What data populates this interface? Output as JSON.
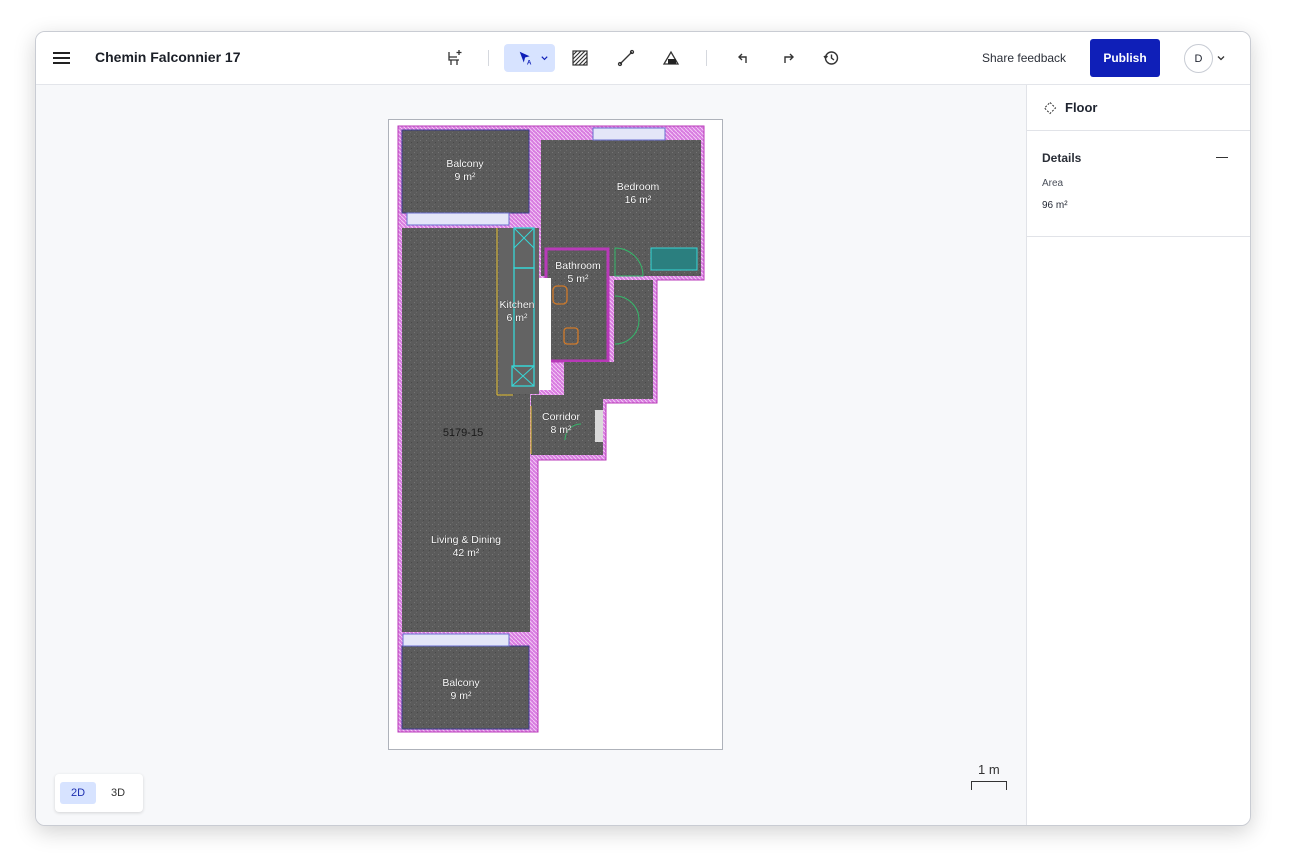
{
  "app": {
    "project_title": "Chemin Falconnier 17"
  },
  "toolbar": {
    "tools": [
      {
        "name": "add-furniture-icon"
      },
      {
        "name": "select-tool-icon"
      },
      {
        "name": "area-hatch-icon"
      },
      {
        "name": "line-draw-icon"
      },
      {
        "name": "roof-icon"
      },
      {
        "name": "undo-icon"
      },
      {
        "name": "redo-icon"
      },
      {
        "name": "history-icon"
      }
    ],
    "share_feedback": "Share feedback",
    "publish": "Publish",
    "user_initial": "D"
  },
  "floorplan": {
    "parcel_number": "5179-15",
    "rooms": [
      {
        "name": "Balcony",
        "area": "9 m²"
      },
      {
        "name": "Bedroom",
        "area": "16 m²"
      },
      {
        "name": "Bathroom",
        "area": "5 m²"
      },
      {
        "name": "Kitchen",
        "area": "6 m²"
      },
      {
        "name": "Corridor",
        "area": "8 m²"
      },
      {
        "name": "Living & Dining",
        "area": "42 m²"
      },
      {
        "name": "Balcony",
        "area": "9 m²"
      }
    ]
  },
  "view_toggle": {
    "two_d": "2D",
    "three_d": "3D",
    "active": "2D"
  },
  "scale": {
    "label": "1 m"
  },
  "panel": {
    "title": "Floor",
    "section": "Details",
    "fields": [
      {
        "label": "Area",
        "value": "96 m²"
      }
    ]
  },
  "colors": {
    "accent": "#0f1fb8",
    "active_tool_bg": "#d7e3ff",
    "wall_outline": "#c23bc4",
    "room_fill": "#5e5e5e"
  }
}
